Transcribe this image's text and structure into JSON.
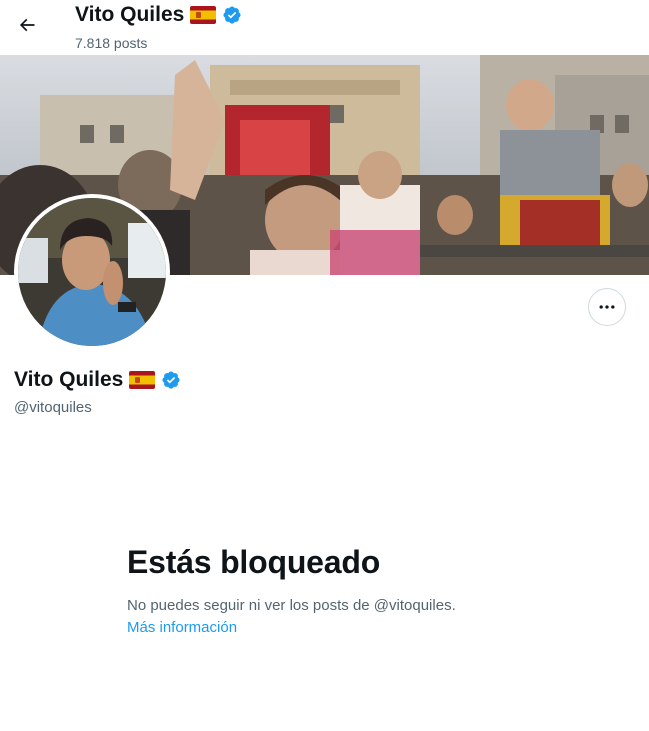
{
  "header": {
    "name": "Vito Quiles",
    "posts_count": "7.818 posts",
    "back_icon": "arrow-left-icon",
    "flag_icon": "spain-flag-icon",
    "verified_icon": "verified-badge-icon"
  },
  "banner": {
    "kind": "photo-crowd-street"
  },
  "profile": {
    "name": "Vito Quiles",
    "handle": "@vitoquiles",
    "more_icon": "more-horizontal-icon"
  },
  "blocked": {
    "title": "Estás bloqueado",
    "description": "No puedes seguir ni ver los posts de @vitoquiles.",
    "link_label": "Más información"
  },
  "colors": {
    "accent": "#1d9bf0",
    "text_primary": "#0f1419",
    "text_secondary": "#536471",
    "border": "#cfd9de"
  }
}
